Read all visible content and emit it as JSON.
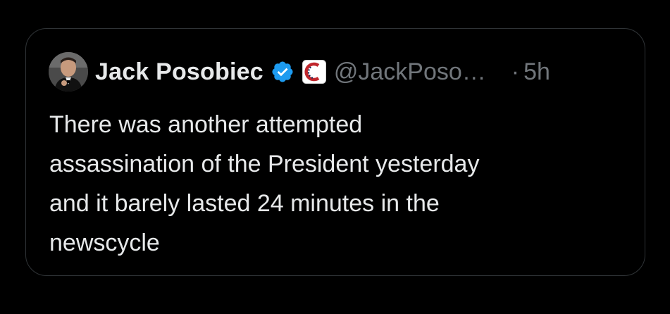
{
  "tweet": {
    "author_name": "Jack Posobiec",
    "handle": "@JackPoso…",
    "dot": "·",
    "timestamp": "5h",
    "text": "There was another attempted\nassassination of the President yesterday\nand it barely lasted 24 minutes in the\nnewscycle",
    "verified": true,
    "avatar": "profile-photo",
    "affiliate_badge": "affiliate-badge-icon"
  },
  "colors": {
    "background": "#000000",
    "card_border": "#2f3336",
    "primary_text": "#e7e9ea",
    "secondary_text": "#71767b",
    "verified_blue": "#1d9bf0",
    "affiliate_red": "#c0262c"
  }
}
